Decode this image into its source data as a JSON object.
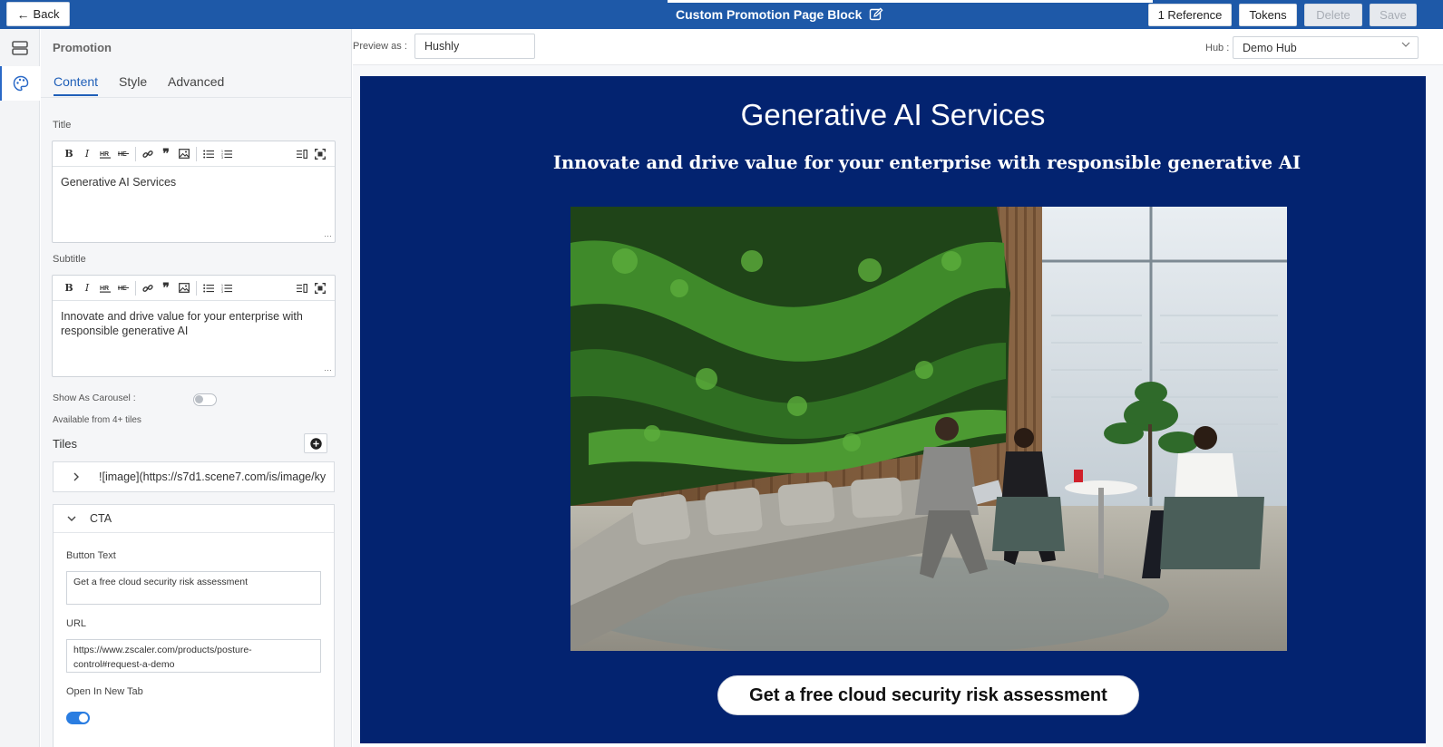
{
  "topbar": {
    "back_label": "Back",
    "page_title": "Custom Promotion Page Block",
    "reference_label": "1 Reference",
    "tokens_label": "Tokens",
    "delete_label": "Delete",
    "save_label": "Save"
  },
  "panel": {
    "title": "Promotion",
    "tabs": [
      {
        "label": "Content"
      },
      {
        "label": "Style"
      },
      {
        "label": "Advanced"
      }
    ],
    "title_field": {
      "label": "Title",
      "value": "Generative AI Services"
    },
    "subtitle_field": {
      "label": "Subtitle",
      "value": "Innovate and drive value for your enterprise with responsible generative AI"
    },
    "carousel": {
      "label": "Show As Carousel :",
      "note": "Available from 4+ tiles",
      "enabled": false
    },
    "tiles": {
      "label": "Tiles",
      "items": [
        "![image](https://s7d1.scene7.com/is/image/ky"
      ]
    },
    "cta": {
      "label": "CTA",
      "button_text_label": "Button Text",
      "button_text_value": "Get a free cloud security risk assessment",
      "url_label": "URL",
      "url_value": "https://www.zscaler.com/products/posture-control#request-a-demo",
      "new_tab_label": "Open In New Tab",
      "new_tab_enabled": true
    }
  },
  "preview": {
    "preview_as_label": "Preview as :",
    "preview_as_value": "Hushly",
    "hub_label": "Hub :",
    "hub_value": "Demo Hub"
  },
  "promo": {
    "title": "Generative AI Services",
    "subtitle": "Innovate and drive value for your enterprise with responsible generative AI",
    "cta_label": "Get a free cloud security risk assessment",
    "image_alt": "office lounge with moss wall and three people meeting"
  },
  "colors": {
    "topbar": "#1e59a8",
    "promo_bg": "#032370",
    "accent": "#2a7de1"
  }
}
